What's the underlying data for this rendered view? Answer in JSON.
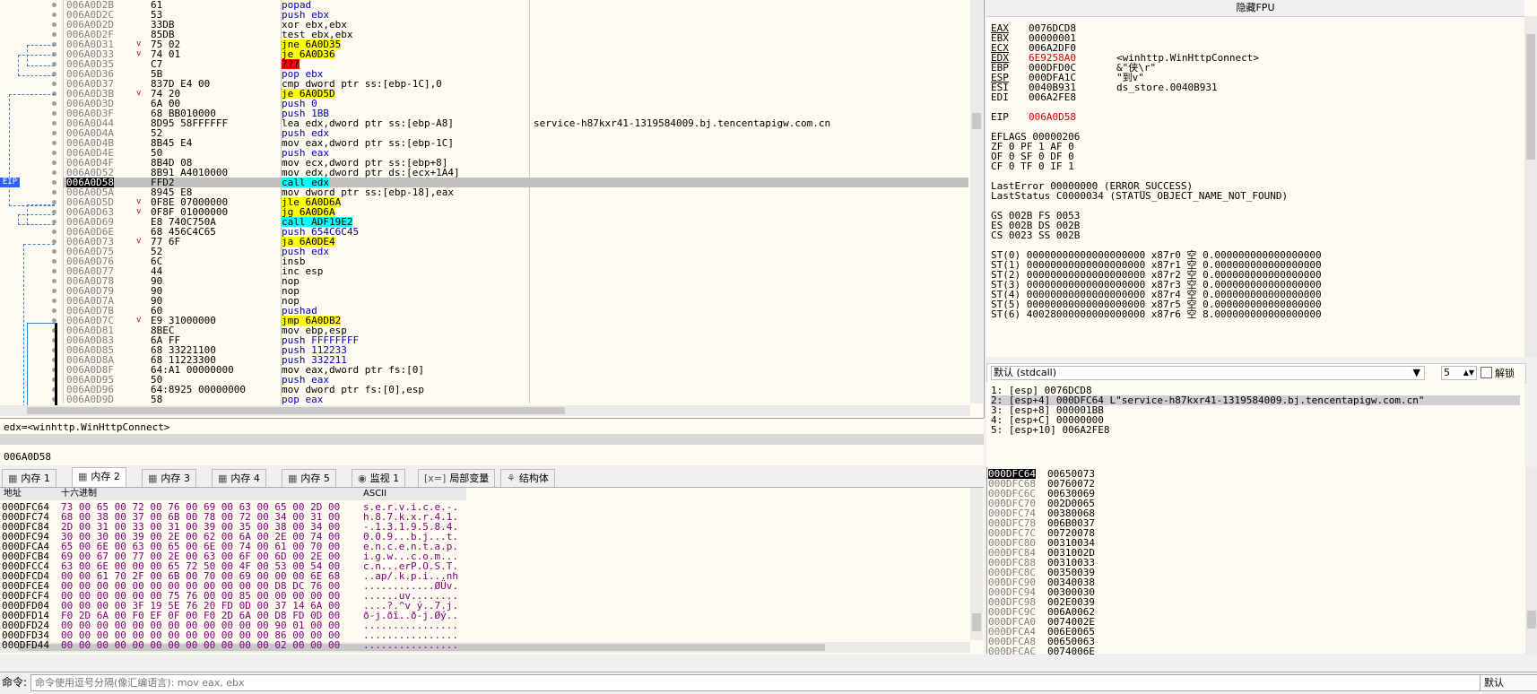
{
  "disassembly": {
    "rows": [
      {
        "addr": "006A0D2B",
        "bytes": "61",
        "ins": "popad",
        "mark": "",
        "cmt": ""
      },
      {
        "addr": "006A0D2C",
        "bytes": "53",
        "ins": "push ebx",
        "mark": "",
        "cmt": ""
      },
      {
        "addr": "006A0D2D",
        "bytes": "33DB",
        "ins": "xor ebx,ebx",
        "mark": "",
        "cmt": ""
      },
      {
        "addr": "006A0D2F",
        "bytes": "85DB",
        "ins": "test ebx,ebx",
        "mark": "",
        "cmt": ""
      },
      {
        "addr": "006A0D31",
        "bytes": "75 02",
        "ins": "jne 6A0D35",
        "mark": "v",
        "cmt": ""
      },
      {
        "addr": "006A0D33",
        "bytes": "74 01",
        "ins": "je 6A0D36",
        "mark": "v",
        "cmt": ""
      },
      {
        "addr": "006A0D35",
        "bytes": "C7",
        "ins": "???",
        "mark": "",
        "cmt": ""
      },
      {
        "addr": "006A0D36",
        "bytes": "5B",
        "ins": "pop ebx",
        "mark": "",
        "cmt": ""
      },
      {
        "addr": "006A0D37",
        "bytes": "837D E4 00",
        "ins": "cmp dword ptr ss:[ebp-1C],0",
        "mark": "",
        "cmt": ""
      },
      {
        "addr": "006A0D3B",
        "bytes": "74 20",
        "ins": "je 6A0D5D",
        "mark": "v",
        "cmt": ""
      },
      {
        "addr": "006A0D3D",
        "bytes": "6A 00",
        "ins": "push 0",
        "mark": "",
        "cmt": ""
      },
      {
        "addr": "006A0D3F",
        "bytes": "68 BB010000",
        "ins": "push 1BB",
        "mark": "",
        "cmt": ""
      },
      {
        "addr": "006A0D44",
        "bytes": "8D95 58FFFFFF",
        "ins": "lea edx,dword ptr ss:[ebp-A8]",
        "mark": "",
        "cmt": "service-h87kxr41-1319584009.bj.tencentapigw.com.cn"
      },
      {
        "addr": "006A0D4A",
        "bytes": "52",
        "ins": "push edx",
        "mark": "",
        "cmt": ""
      },
      {
        "addr": "006A0D4B",
        "bytes": "8B45 E4",
        "ins": "mov eax,dword ptr ss:[ebp-1C]",
        "mark": "",
        "cmt": ""
      },
      {
        "addr": "006A0D4E",
        "bytes": "50",
        "ins": "push eax",
        "mark": "",
        "cmt": ""
      },
      {
        "addr": "006A0D4F",
        "bytes": "8B4D 08",
        "ins": "mov ecx,dword ptr ss:[ebp+8]",
        "mark": "",
        "cmt": ""
      },
      {
        "addr": "006A0D52",
        "bytes": "8B91 A4010000",
        "ins": "mov edx,dword ptr ds:[ecx+1A4]",
        "mark": "",
        "cmt": ""
      },
      {
        "addr": "006A0D58",
        "bytes": "FFD2",
        "ins": "call edx",
        "mark": "",
        "cmt": ""
      },
      {
        "addr": "006A0D5A",
        "bytes": "8945 E8",
        "ins": "mov dword ptr ss:[ebp-18],eax",
        "mark": "",
        "cmt": ""
      },
      {
        "addr": "006A0D5D",
        "bytes": "0F8E 07000000",
        "ins": "jle 6A0D6A",
        "mark": "v",
        "cmt": ""
      },
      {
        "addr": "006A0D63",
        "bytes": "0F8F 01000000",
        "ins": "jg 6A0D6A",
        "mark": "v",
        "cmt": ""
      },
      {
        "addr": "006A0D69",
        "bytes": "E8 740C750A",
        "ins": "call ADF19E2",
        "mark": "",
        "cmt": ""
      },
      {
        "addr": "006A0D6E",
        "bytes": "68 456C4C65",
        "ins": "push 654C6C45",
        "mark": "",
        "cmt": ""
      },
      {
        "addr": "006A0D73",
        "bytes": "77 6F",
        "ins": "ja 6A0DE4",
        "mark": "v",
        "cmt": ""
      },
      {
        "addr": "006A0D75",
        "bytes": "52",
        "ins": "push edx",
        "mark": "",
        "cmt": ""
      },
      {
        "addr": "006A0D76",
        "bytes": "6C",
        "ins": "insb",
        "mark": "",
        "cmt": ""
      },
      {
        "addr": "006A0D77",
        "bytes": "44",
        "ins": "inc esp",
        "mark": "",
        "cmt": ""
      },
      {
        "addr": "006A0D78",
        "bytes": "90",
        "ins": "nop",
        "mark": "",
        "cmt": ""
      },
      {
        "addr": "006A0D79",
        "bytes": "90",
        "ins": "nop",
        "mark": "",
        "cmt": ""
      },
      {
        "addr": "006A0D7A",
        "bytes": "90",
        "ins": "nop",
        "mark": "",
        "cmt": ""
      },
      {
        "addr": "006A0D7B",
        "bytes": "60",
        "ins": "pushad",
        "mark": "",
        "cmt": ""
      },
      {
        "addr": "006A0D7C",
        "bytes": "E9 31000000",
        "ins": "jmp 6A0DB2",
        "mark": "v",
        "cmt": ""
      },
      {
        "addr": "006A0D81",
        "bytes": "8BEC",
        "ins": "mov ebp,esp",
        "mark": "",
        "cmt": ""
      },
      {
        "addr": "006A0D83",
        "bytes": "6A FF",
        "ins": "push FFFFFFFF",
        "mark": "",
        "cmt": ""
      },
      {
        "addr": "006A0D85",
        "bytes": "68 33221100",
        "ins": "push 112233",
        "mark": "",
        "cmt": ""
      },
      {
        "addr": "006A0D8A",
        "bytes": "68 11223300",
        "ins": "push 332211",
        "mark": "",
        "cmt": ""
      },
      {
        "addr": "006A0D8F",
        "bytes": "64:A1 00000000",
        "ins": "mov eax,dword ptr fs:[0]",
        "mark": "",
        "cmt": ""
      },
      {
        "addr": "006A0D95",
        "bytes": "50",
        "ins": "push eax",
        "mark": "",
        "cmt": ""
      },
      {
        "addr": "006A0D96",
        "bytes": "64:8925 00000000",
        "ins": "mov dword ptr fs:[0],esp",
        "mark": "",
        "cmt": ""
      },
      {
        "addr": "006A0D9D",
        "bytes": "58",
        "ins": "pop eax",
        "mark": "",
        "cmt": ""
      }
    ],
    "eip_label": "EIP",
    "current_addr": "006A0D58"
  },
  "info": {
    "line1": "edx=<winhttp.WinHttpConnect>",
    "line2": "006A0D58"
  },
  "registers": {
    "title": "隐藏FPU",
    "gp": [
      {
        "name": "EAX",
        "value": "0076DCD8",
        "cmt": "",
        "ul": true,
        "red": false
      },
      {
        "name": "EBX",
        "value": "00000001",
        "cmt": "",
        "ul": false,
        "red": false
      },
      {
        "name": "ECX",
        "value": "006A2DF0",
        "cmt": "",
        "ul": true,
        "red": false
      },
      {
        "name": "EDX",
        "value": "6E9258A0",
        "cmt": "<winhttp.WinHttpConnect>",
        "ul": true,
        "red": true
      },
      {
        "name": "EBP",
        "value": "000DFD0C",
        "cmt": "&\"侠\\r\"",
        "ul": false,
        "red": false
      },
      {
        "name": "ESP",
        "value": "000DFA1C",
        "cmt": "\"到v\"",
        "ul": true,
        "red": false
      },
      {
        "name": "ESI",
        "value": "0040B931",
        "cmt": "ds_store.0040B931",
        "ul": false,
        "red": false
      },
      {
        "name": "EDI",
        "value": "006A2FE8",
        "cmt": "",
        "ul": false,
        "red": false
      }
    ],
    "eip": {
      "name": "EIP",
      "value": "006A0D58"
    },
    "eflags": "EFLAGS   00000206",
    "flags": [
      "ZF 0  PF 1  AF 0",
      "OF 0  SF 0  DF 0",
      "CF 0  TF 0  IF 1"
    ],
    "lasterror": "LastError  00000000 (ERROR_SUCCESS)",
    "laststatus": "LastStatus C0000034 (STATUS_OBJECT_NAME_NOT_FOUND)",
    "segs": [
      "GS 002B  FS 0053",
      "ES 002B  DS 002B",
      "CS 0023  SS 002B"
    ],
    "fpu": [
      "ST(0) 00000000000000000000 x87r0 空 0.000000000000000000",
      "ST(1) 00000000000000000000 x87r1 空 0.000000000000000000",
      "ST(2) 00000000000000000000 x87r2 空 0.000000000000000000",
      "ST(3) 00000000000000000000 x87r3 空 0.000000000000000000",
      "ST(4) 00000000000000000000 x87r4 空 0.000000000000000000",
      "ST(5) 00000000000000000000 x87r5 空 0.000000000000000000",
      "ST(6) 40028000000000000000 x87r6 空 8.000000000000000000"
    ]
  },
  "callconv": {
    "label": "默认 (stdcall)",
    "count": "5",
    "unlock_label": "解锁"
  },
  "stack_args": [
    "1: [esp] 0076DCD8",
    "2: [esp+4] 000DFC64 L\"service-h87kxr41-1319584009.bj.tencentapigw.com.cn\"",
    "3: [esp+8] 000001BB",
    "4: [esp+C] 00000000",
    "5: [esp+10] 006A2FE8"
  ],
  "tabs": [
    {
      "label": "内存 1",
      "icon": "memory-icon"
    },
    {
      "label": "内存 2",
      "icon": "memory-icon"
    },
    {
      "label": "内存 3",
      "icon": "memory-icon"
    },
    {
      "label": "内存 4",
      "icon": "memory-icon"
    },
    {
      "label": "内存 5",
      "icon": "memory-icon"
    },
    {
      "label": "监视 1",
      "icon": "watch-icon"
    },
    {
      "label": "局部变量",
      "icon": "locals-icon"
    },
    {
      "label": "结构体",
      "icon": "struct-icon"
    }
  ],
  "dump": {
    "col_addr": "地址",
    "col_hex": "十六进制",
    "col_ascii": "ASCII",
    "rows": [
      {
        "addr": "000DFC64",
        "hex": "73 00 65 00 72 00 76 00 69 00 63 00 65 00 2D 00",
        "ascii": "s.e.r.v.i.c.e.-."
      },
      {
        "addr": "000DFC74",
        "hex": "68 00 38 00 37 00 6B 00 78 00 72 00 34 00 31 00",
        "ascii": "h.8.7.k.x.r.4.1."
      },
      {
        "addr": "000DFC84",
        "hex": "2D 00 31 00 33 00 31 00 39 00 35 00 38 00 34 00",
        "ascii": "-.1.3.1.9.5.8.4."
      },
      {
        "addr": "000DFC94",
        "hex": "30 00 30 00 39 00 2E 00 62 00 6A 00 2E 00 74 00",
        "ascii": "0.0.9...b.j...t."
      },
      {
        "addr": "000DFCA4",
        "hex": "65 00 6E 00 63 00 65 00 6E 00 74 00 61 00 70 00",
        "ascii": "e.n.c.e.n.t.a.p."
      },
      {
        "addr": "000DFCB4",
        "hex": "69 00 67 00 77 00 2E 00 63 00 6F 00 6D 00 2E 00",
        "ascii": "i.g.w...c.o.m..."
      },
      {
        "addr": "000DFCC4",
        "hex": "63 00 6E 00 00 00 65 72 50 00 4F 00 53 00 54 00",
        "ascii": "c.n...erP.O.S.T."
      },
      {
        "addr": "000DFCD4",
        "hex": "00 00 61 70 2F 00 6B 00 70 00 69 00 00 00 6E 68",
        "ascii": "..ap/.k.p.i...nh"
      },
      {
        "addr": "000DFCE4",
        "hex": "00 00 00 00 00 00 00 00 00 00 00 00 D8 DC 76 00",
        "ascii": "............ØÜv."
      },
      {
        "addr": "000DFCF4",
        "hex": "00 00 00 00 00 00 75 76 00 00 85 00 00 00 00 00",
        "ascii": "......uv........"
      },
      {
        "addr": "000DFD04",
        "hex": "00 00 00 00 3F 19 5E 76 20 FD 0D 00 37 14 6A 00",
        "ascii": "....?.^v ý..7.j."
      },
      {
        "addr": "000DFD14",
        "hex": "F0 2D 6A 00 F0 EF 0F 00 F0 2D 6A 00 D8 FD 0D 00",
        "ascii": "ð-j.ðï..ð-j.Øý.."
      },
      {
        "addr": "000DFD24",
        "hex": "00 00 00 00 00 00 00 00 00 00 00 00 90 01 00 00",
        "ascii": "................"
      },
      {
        "addr": "000DFD34",
        "hex": "00 00 00 00 00 00 00 00 00 00 00 00 86 00 00 00",
        "ascii": "................"
      },
      {
        "addr": "000DFD44",
        "hex": "00 00 00 00 00 00 00 00 00 00 00 00 02 00 00 00",
        "ascii": "................"
      }
    ]
  },
  "stack": {
    "rows": [
      {
        "addr": "000DFC64",
        "val": "00650073"
      },
      {
        "addr": "000DFC68",
        "val": "00760072"
      },
      {
        "addr": "000DFC6C",
        "val": "00630069"
      },
      {
        "addr": "000DFC70",
        "val": "002D0065"
      },
      {
        "addr": "000DFC74",
        "val": "00380068"
      },
      {
        "addr": "000DFC78",
        "val": "006B0037"
      },
      {
        "addr": "000DFC7C",
        "val": "00720078"
      },
      {
        "addr": "000DFC80",
        "val": "00310034"
      },
      {
        "addr": "000DFC84",
        "val": "0031002D"
      },
      {
        "addr": "000DFC88",
        "val": "00310033"
      },
      {
        "addr": "000DFC8C",
        "val": "00350039"
      },
      {
        "addr": "000DFC90",
        "val": "00340038"
      },
      {
        "addr": "000DFC94",
        "val": "00300030"
      },
      {
        "addr": "000DFC98",
        "val": "002E0039"
      },
      {
        "addr": "000DFC9C",
        "val": "006A0062"
      },
      {
        "addr": "000DFCA0",
        "val": "0074002E"
      },
      {
        "addr": "000DFCA4",
        "val": "006E0065"
      },
      {
        "addr": "000DFCA8",
        "val": "00650063"
      },
      {
        "addr": "000DFCAC",
        "val": "0074006E"
      }
    ]
  },
  "command": {
    "label": "命令:",
    "placeholder": "命令使用逗号分隔(像汇编语言): mov eax, ebx",
    "default_label": "默认"
  }
}
